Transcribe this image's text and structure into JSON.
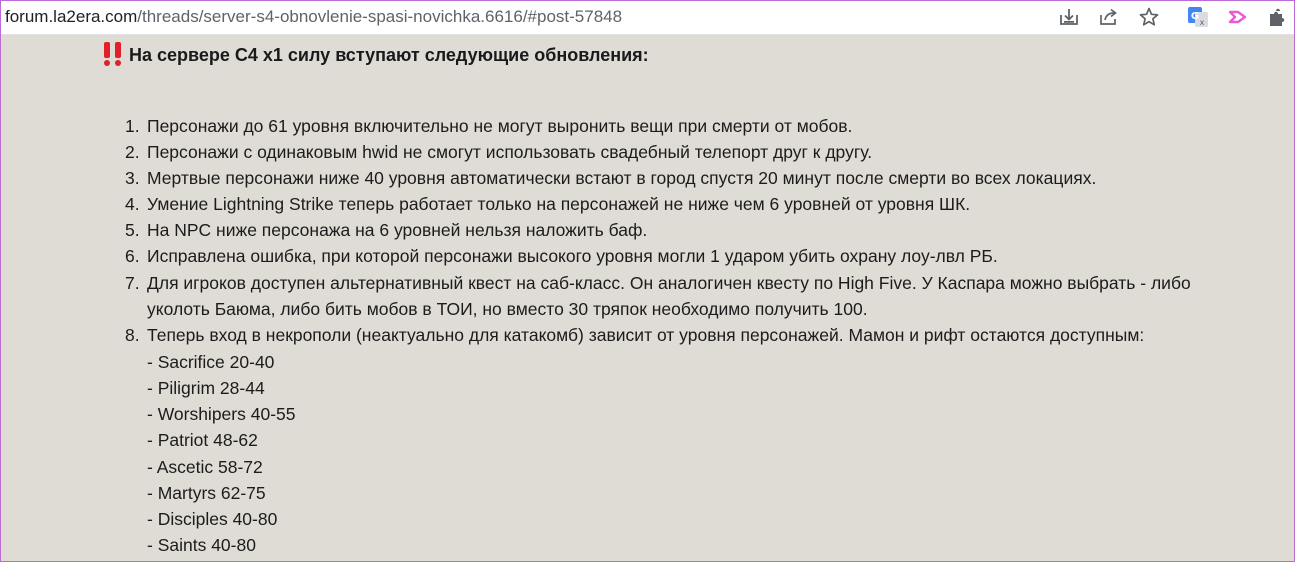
{
  "browser": {
    "url_host": "forum.la2era.com",
    "url_path": "/threads/server-s4-obnovlenie-spasi-novichka.6616/#post-57848",
    "toolbar_icons": [
      "download-icon",
      "share-icon",
      "star-icon",
      "google-translate-icon",
      "extension-arrow-icon",
      "puzzle-icon"
    ]
  },
  "post": {
    "heading_icon": "double-exclamation-icon",
    "heading": "На сервере С4 х1 силу вступают следующие обновления:",
    "items": [
      {
        "num": "1.",
        "lines": [
          "Персонажи до 61 уровня включительно не могут выронить вещи при смерти от мобов."
        ]
      },
      {
        "num": "2.",
        "lines": [
          "Персонажи с одинаковым hwid не смогут использовать свадебный телепорт друг к другу."
        ]
      },
      {
        "num": "3.",
        "lines": [
          "Мертвые персонажи ниже 40 уровня автоматически встают в город спустя 20 минут после смерти во всех локациях."
        ]
      },
      {
        "num": "4.",
        "lines": [
          "Умение Lightning Strike теперь работает только на персонажей не ниже чем 6 уровней от уровня ШК."
        ]
      },
      {
        "num": "5.",
        "lines": [
          "На NPC ниже персонажа на 6 уровней нельзя наложить баф."
        ]
      },
      {
        "num": "6.",
        "lines": [
          "Исправлена ошибка, при которой персонажи высокого уровня могли 1 ударом убить охрану лоу-лвл РБ."
        ]
      },
      {
        "num": "7.",
        "lines": [
          "Для игроков доступен альтернативный квест на саб-класс. Он аналогичен квесту по High Five. У Каспара можно выбрать - либо",
          "уколоть Баюма, либо бить мобов в ТОИ, но вместо 30 тряпок необходимо получить 100."
        ]
      },
      {
        "num": "8.",
        "lines": [
          "Теперь вход в некрополи (неактуально для катакомб) зависит от уровня персонажей. Мамон и рифт остаются доступным:"
        ]
      }
    ],
    "necropolis": [
      "- Sacrifice 20-40",
      "- Piligrim 28-44",
      "- Worshipers 40-55",
      "- Patriot 48-62",
      "- Ascetic 58-72",
      "- Martyrs 62-75",
      "- Disciples 40-80",
      "- Saints 40-80"
    ]
  },
  "colors": {
    "content_bg": "#dfdbd5",
    "frame_border": "#bc6bd6",
    "bang_red": "#e0202a",
    "translate_blue": "#4285f4",
    "extension_pink": "#e85bd6"
  }
}
